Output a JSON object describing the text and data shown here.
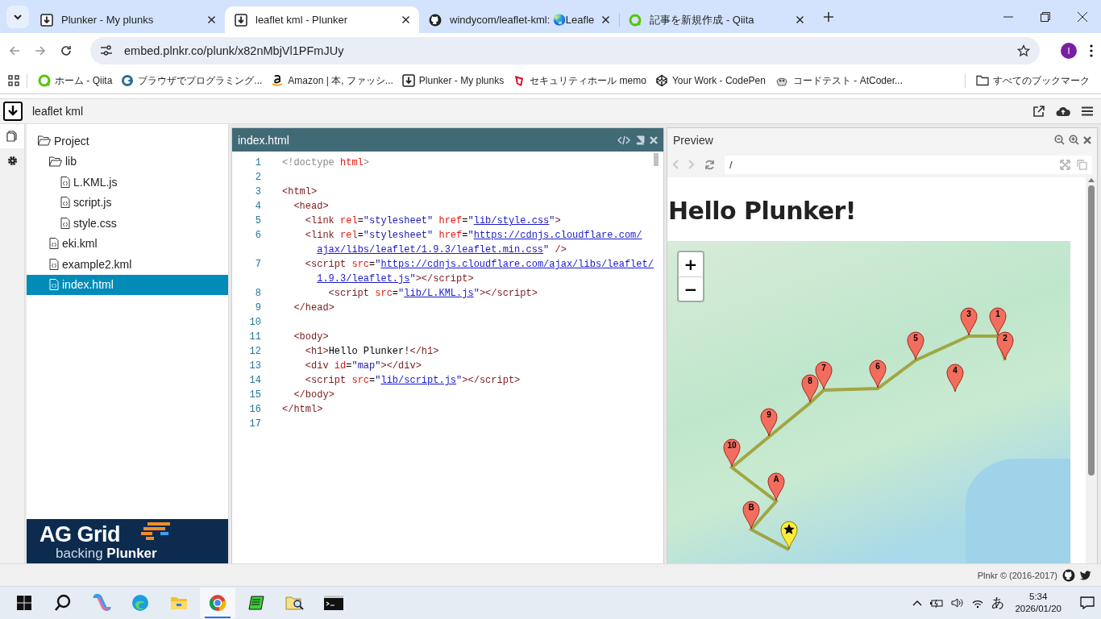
{
  "browser": {
    "tabs": [
      {
        "title": "Plunker - My plunks",
        "selected": false
      },
      {
        "title": "leaflet kml - Plunker",
        "selected": true
      },
      {
        "title": "windycom/leaflet-kml: 🌏Leafle",
        "selected": false
      },
      {
        "title": "記事を新規作成 - Qiita",
        "selected": false
      }
    ],
    "address": "embed.plnkr.co/plunk/x82nMbjVl1PFmJUy",
    "profile_initial": "I",
    "bookmarks": [
      {
        "title": "ホーム - Qiita"
      },
      {
        "title": "ブラウザでプログラミング..."
      },
      {
        "title": "Amazon | 本, ファッシ..."
      },
      {
        "title": "Plunker - My plunks"
      },
      {
        "title": "セキュリティホール memo"
      },
      {
        "title": "Your Work - CodePen"
      },
      {
        "title": "コードテスト - AtCoder..."
      }
    ],
    "all_bookmarks": "すべてのブックマーク"
  },
  "plunk": {
    "title": "leaflet kml"
  },
  "files": [
    {
      "name": "Project",
      "kind": "folder",
      "expanded": true,
      "selected": false,
      "children": [
        {
          "name": "lib",
          "kind": "folder",
          "expanded": true,
          "selected": false,
          "children": [
            {
              "name": "L.KML.js",
              "kind": "file",
              "selected": false
            },
            {
              "name": "script.js",
              "kind": "file",
              "selected": false
            },
            {
              "name": "style.css",
              "kind": "file",
              "selected": false
            }
          ]
        },
        {
          "name": "eki.kml",
          "kind": "file",
          "selected": false
        },
        {
          "name": "example2.kml",
          "kind": "file",
          "selected": false
        },
        {
          "name": "index.html",
          "kind": "file",
          "selected": true
        }
      ]
    }
  ],
  "ad": {
    "title": "AG Grid",
    "subtitle": "backing **Plunker**"
  },
  "editor": {
    "title": "index.html",
    "lines": [
      {
        "number": "1",
        "rows": [
          "<!doctype html>"
        ]
      },
      {
        "number": "2"
      },
      {
        "number": "3",
        "rows": [
          "<html>"
        ]
      },
      {
        "number": "4",
        "rows": [
          "  <head>"
        ]
      },
      {
        "number": "5",
        "rows": [
          "    <link rel=\"stylesheet\" href=\"lib/style.css\">"
        ]
      },
      {
        "number": "6",
        "rows": [
          "    <link rel=\"stylesheet\" href=\"https://cdnjs.cloudflare.com/",
          "      ajax/libs/leaflet/1.9.3/leaflet.min.css\" />"
        ]
      },
      {
        "number": "7",
        "rows": [
          "    <script src=\"https://cdnjs.cloudflare.com/ajax/libs/leaflet/",
          "      1.9.3/leaflet.js\"></script>"
        ]
      },
      {
        "number": "8",
        "rows": [
          "        <script src=\"lib/L.KML.js\"></script>"
        ]
      },
      {
        "number": "9",
        "rows": [
          "  </head>"
        ]
      },
      {
        "number": "10"
      },
      {
        "number": "11",
        "rows": [
          "  <body>"
        ]
      },
      {
        "number": "12",
        "rows": [
          "    <h1>Hello Plunker!</h1>"
        ]
      },
      {
        "number": "13",
        "rows": [
          "    <div id=\"map\"></div>"
        ]
      },
      {
        "number": "14",
        "rows": [
          "    <script src=\"lib/script.js\"></script>"
        ]
      },
      {
        "number": "15",
        "rows": [
          "  </body>"
        ]
      },
      {
        "number": "16",
        "rows": [
          "</html>"
        ]
      },
      {
        "number": "17"
      }
    ]
  },
  "preview": {
    "title": "Preview",
    "url": "/",
    "heading": "Hello Plunker!",
    "map": {
      "zoom_in": "+",
      "zoom_out": "−",
      "markers": [
        {
          "kind": "numbered",
          "label": "1"
        },
        {
          "kind": "numbered",
          "label": "2"
        },
        {
          "kind": "numbered",
          "label": "3"
        },
        {
          "kind": "numbered",
          "label": "4"
        },
        {
          "kind": "numbered",
          "label": "5"
        },
        {
          "kind": "numbered",
          "label": "6"
        },
        {
          "kind": "numbered",
          "label": "7"
        },
        {
          "kind": "numbered",
          "label": "8"
        },
        {
          "kind": "numbered",
          "label": "9"
        },
        {
          "kind": "numbered",
          "label": "10"
        },
        {
          "kind": "numbered",
          "label": "A"
        },
        {
          "kind": "numbered",
          "label": "B"
        },
        {
          "kind": "star"
        }
      ]
    }
  },
  "footer": {
    "text": "Plnkr © (2016-2017)"
  },
  "taskbar": {
    "ime": "あ",
    "time": "5:34",
    "date": "2026/01/20"
  }
}
